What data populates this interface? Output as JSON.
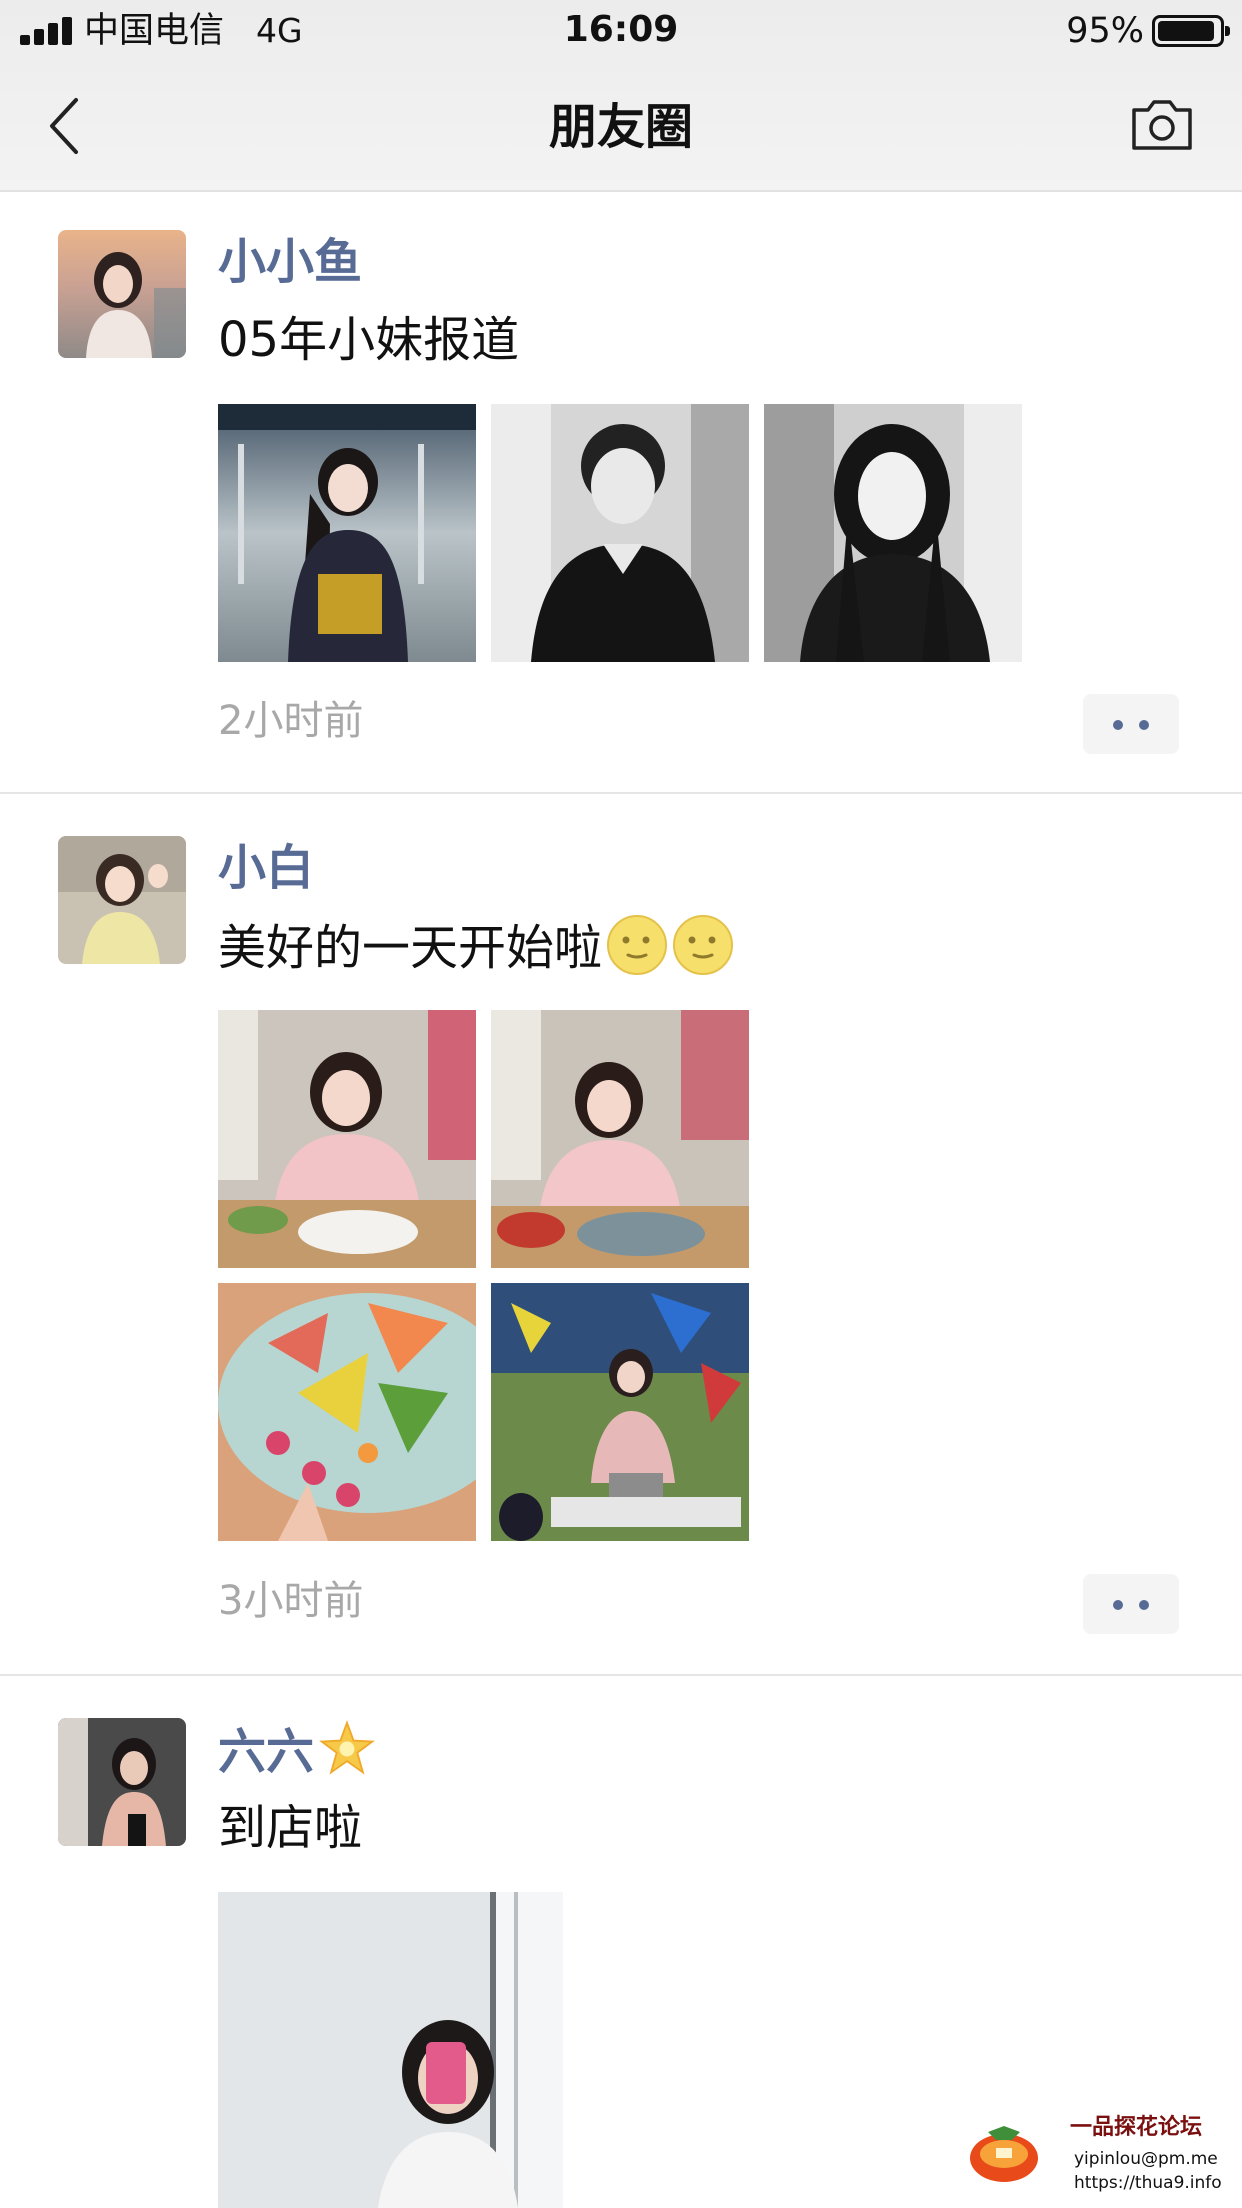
{
  "status_bar": {
    "carrier": "中国电信",
    "network": "4G",
    "time": "16:09",
    "battery": "95%",
    "battery_level": 0.95
  },
  "header": {
    "title": "朋友圈",
    "back_icon": "chevron-left-icon",
    "camera_icon": "camera-icon"
  },
  "posts": [
    {
      "name": "小小鱼",
      "text": "05年小妹报道",
      "time": "2小时前",
      "photo_count": 3
    },
    {
      "name": "小白",
      "text": "美好的一天开始啦",
      "emoji": [
        "full-moon-face-emoji",
        "full-moon-face-emoji"
      ],
      "time": "3小时前",
      "photo_count": 4
    },
    {
      "name": "六六",
      "name_emoji": "glowing-star-emoji",
      "text": "到店啦",
      "photo_count": 1
    }
  ],
  "watermark": {
    "title": "一品探花论坛",
    "email": "yipinlou@pm.me",
    "url": "https://thua9.info"
  },
  "colors": {
    "name_link": "#576b95",
    "timestamp": "#a8a8a8",
    "header_bg": "#ededed",
    "divider": "#e6e6e6"
  }
}
